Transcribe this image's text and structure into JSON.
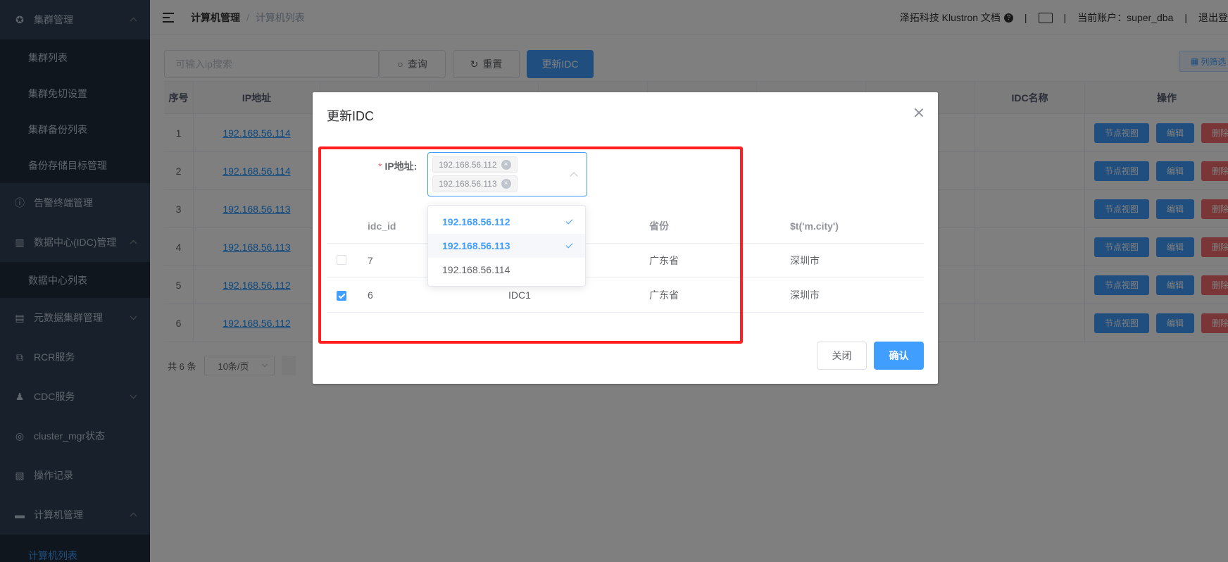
{
  "sidebar": {
    "items": [
      {
        "label": "集群管理",
        "icon": "cluster-icon",
        "expanded": true
      },
      {
        "label": "集群列表"
      },
      {
        "label": "集群免切设置"
      },
      {
        "label": "集群备份列表"
      },
      {
        "label": "备份存储目标管理"
      },
      {
        "label": "告警终端管理",
        "icon": "alert-icon"
      },
      {
        "label": "数据中心(IDC)管理",
        "icon": "datacenter-icon",
        "expanded": true
      },
      {
        "label": "数据中心列表"
      },
      {
        "label": "元数据集群管理",
        "icon": "metadata-icon"
      },
      {
        "label": "RCR服务",
        "icon": "rcr-icon"
      },
      {
        "label": "CDC服务",
        "icon": "cdc-icon"
      },
      {
        "label": "cluster_mgr状态",
        "icon": "status-icon"
      },
      {
        "label": "操作记录",
        "icon": "record-icon"
      },
      {
        "label": "计算机管理",
        "icon": "computer-icon",
        "expanded": true
      },
      {
        "label": "计算机列表",
        "active": true
      }
    ]
  },
  "navbar": {
    "breadcrumb": [
      "计算机管理",
      "计算机列表"
    ],
    "breadcrumb_sep": "/",
    "docs": "泽拓科技 Klustron 文档",
    "sep": "|",
    "account": "当前账户：super_dba",
    "logout": "退出登"
  },
  "toolbar": {
    "search_placeholder": "可输入ip搜索",
    "query": "查询",
    "reset": "重置",
    "update_idc": "更新IDC",
    "column_filter": "列筛选"
  },
  "table": {
    "headers": [
      "序号",
      "IP地址",
      "IDC名称",
      "操作"
    ],
    "rows": [
      {
        "no": "1",
        "ip": "192.168.56.114"
      },
      {
        "no": "2",
        "ip": "192.168.56.114"
      },
      {
        "no": "3",
        "ip": "192.168.56.113"
      },
      {
        "no": "4",
        "ip": "192.168.56.113"
      },
      {
        "no": "5",
        "ip": "192.168.56.112"
      },
      {
        "no": "6",
        "ip": "192.168.56.112"
      }
    ],
    "actions": {
      "node_view": "节点视图",
      "edit": "编辑",
      "delete": "删除"
    }
  },
  "pager": {
    "total": "共 6 条",
    "page_size": "10条/页"
  },
  "dialog": {
    "title": "更新IDC",
    "ip_label": "IP地址:",
    "required_mark": "*",
    "selected_tags": [
      "192.168.56.112",
      "192.168.56.113"
    ],
    "tag_close": "×",
    "options": [
      {
        "label": "192.168.56.112",
        "selected": true
      },
      {
        "label": "192.168.56.113",
        "selected": true
      },
      {
        "label": "192.168.56.114",
        "selected": false
      }
    ],
    "columns": [
      "idc_id",
      "",
      "省份",
      "$t('m.city')"
    ],
    "rows": [
      {
        "checked": false,
        "idc_id": "7",
        "name": "",
        "province": "广东省",
        "city": "深圳市"
      },
      {
        "checked": true,
        "idc_id": "6",
        "name": "IDC1",
        "province": "广东省",
        "city": "深圳市"
      }
    ],
    "close": "关闭",
    "confirm": "确认"
  },
  "colors": {
    "primary": "#409eff",
    "danger": "#f56c6c",
    "sidebar": "#304156",
    "highlight_box": "#ff1f1f"
  }
}
